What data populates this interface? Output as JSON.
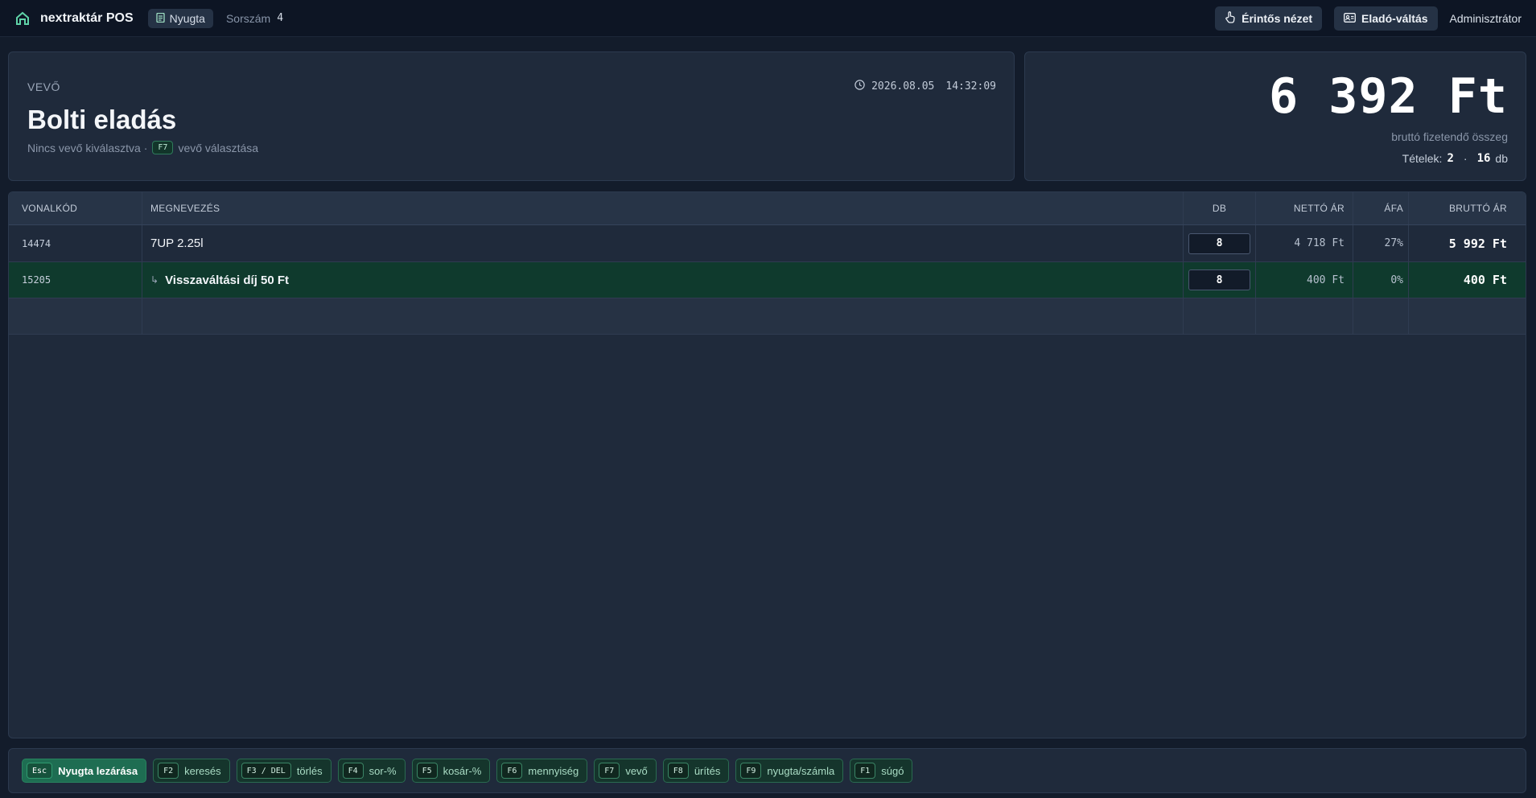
{
  "topbar": {
    "app_title": "nextraktár POS",
    "mode_label": "Nyugta",
    "seq_label": "Sorszám",
    "seq_value": "4",
    "touch_view_label": "Érintős nézet",
    "seller_switch_label": "Eladó-váltás",
    "user_label": "Adminisztrátor"
  },
  "customer": {
    "section_label": "VEVŐ",
    "title": "Bolti eladás",
    "subtitle_prefix": "Nincs vevő kiválasztva ·",
    "select_key": "F7",
    "select_label": "vevő választása",
    "date": "2026.08.05",
    "time": "14:32:09"
  },
  "totals": {
    "amount": "6 392 Ft",
    "caption": "bruttó fizetendő összeg",
    "items_label": "Tételek:",
    "items_count": "2",
    "separator": "·",
    "qty_total": "16",
    "qty_unit": "db"
  },
  "table": {
    "headers": {
      "code": "VONALKÓD",
      "name": "MEGNEVEZÉS",
      "qty": "DB",
      "net": "NETTÓ ÁR",
      "vat": "ÁFA",
      "gross": "BRUTTÓ ÁR"
    },
    "rows": [
      {
        "code": "14474",
        "name": "7UP 2.25l",
        "qty": "8",
        "net": "4 718 Ft",
        "vat": "27%",
        "gross": "5 992 Ft"
      },
      {
        "code": "15205",
        "prefix": "↳",
        "name": "Visszaváltási díj 50 Ft",
        "qty": "8",
        "net": "400 Ft",
        "vat": "0%",
        "gross": "400 Ft"
      }
    ]
  },
  "shortcuts": [
    {
      "key": "Esc",
      "label": "Nyugta lezárása"
    },
    {
      "key": "F2",
      "label": "keresés"
    },
    {
      "key": "F3 / DEL",
      "label": "törlés"
    },
    {
      "key": "F4",
      "label": "sor-%"
    },
    {
      "key": "F5",
      "label": "kosár-%"
    },
    {
      "key": "F6",
      "label": "mennyiség"
    },
    {
      "key": "F7",
      "label": "vevő"
    },
    {
      "key": "F8",
      "label": "ürítés"
    },
    {
      "key": "F9",
      "label": "nyugta/számla"
    },
    {
      "key": "F1",
      "label": "súgó"
    }
  ],
  "colors": {
    "accent_green": "#1e6d52",
    "selected_row": "#0f3a2d",
    "background": "#131c2b"
  },
  "icons": {
    "logo": "home-icon",
    "mode": "receipt-icon",
    "touch": "hand-pointer-icon",
    "seller": "id-card-icon",
    "time": "clock-icon"
  }
}
